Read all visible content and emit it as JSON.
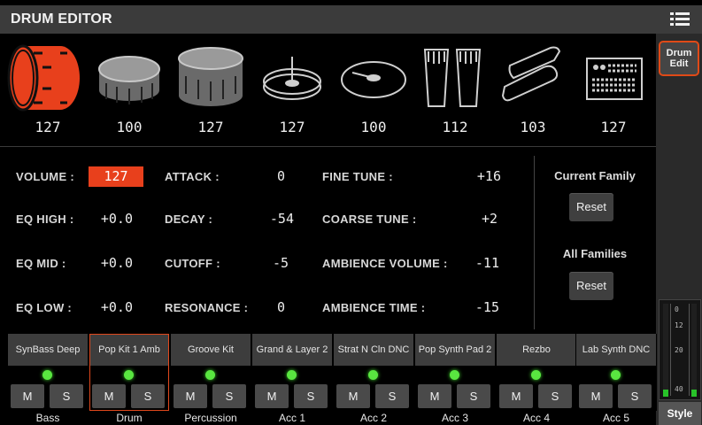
{
  "header": {
    "title": "DRUM EDITOR",
    "menu_icon": "hamburger-menu-icon"
  },
  "sidebar": {
    "drum_edit_label_1": "Drum",
    "drum_edit_label_2": "Edit",
    "style_label": "Style"
  },
  "meter": {
    "ticks": [
      "0",
      "12",
      "20",
      "40"
    ],
    "left_level": 0.08,
    "right_level": 0.08,
    "color": "#28c229"
  },
  "families": [
    {
      "icon": "kick-drum-icon",
      "value": "127",
      "selected": true
    },
    {
      "icon": "snare-drum-icon",
      "value": "100"
    },
    {
      "icon": "tom-drum-icon",
      "value": "127"
    },
    {
      "icon": "hihat-cymbal-icon",
      "value": "127"
    },
    {
      "icon": "ride-cymbal-icon",
      "value": "100"
    },
    {
      "icon": "conga-icon",
      "value": "112"
    },
    {
      "icon": "shaker-icon",
      "value": "103"
    },
    {
      "icon": "drum-machine-icon",
      "value": "127"
    }
  ],
  "params": {
    "volume": {
      "label": "VOLUME :",
      "value": "127"
    },
    "attack": {
      "label": "ATTACK :",
      "value": "0"
    },
    "fine_tune": {
      "label": "FINE TUNE :",
      "value": "+16"
    },
    "eq_high": {
      "label": "EQ HIGH :",
      "value": "+0.0"
    },
    "decay": {
      "label": "DECAY :",
      "value": "-54"
    },
    "coarse_tune": {
      "label": "COARSE TUNE :",
      "value": "+2"
    },
    "eq_mid": {
      "label": "EQ MID :",
      "value": "+0.0"
    },
    "cutoff": {
      "label": "CUTOFF :",
      "value": "-5"
    },
    "ambience_volume": {
      "label": "AMBIENCE VOLUME :",
      "value": "-11"
    },
    "eq_low": {
      "label": "EQ LOW :",
      "value": "+0.0"
    },
    "resonance": {
      "label": "RESONANCE :",
      "value": "0"
    },
    "ambience_time": {
      "label": "AMBIENCE TIME :",
      "value": "-15"
    }
  },
  "reset": {
    "current_family_label": "Current Family",
    "all_families_label": "All Families",
    "reset_label": "Reset"
  },
  "tracks": [
    {
      "name": "SynBass Deep",
      "label": "Bass",
      "m": "M",
      "s": "S"
    },
    {
      "name": "Pop Kit 1 Amb",
      "label": "Drum",
      "m": "M",
      "s": "S",
      "selected": true
    },
    {
      "name": "Groove Kit",
      "label": "Percussion",
      "m": "M",
      "s": "S"
    },
    {
      "name": "Grand & Layer 2",
      "label": "Acc 1",
      "m": "M",
      "s": "S"
    },
    {
      "name": "Strat N Cln DNC",
      "label": "Acc 2",
      "m": "M",
      "s": "S"
    },
    {
      "name": "Pop Synth Pad 2",
      "label": "Acc 3",
      "m": "M",
      "s": "S"
    },
    {
      "name": "Rezbo",
      "label": "Acc 4",
      "m": "M",
      "s": "S"
    },
    {
      "name": "Lab Synth DNC",
      "label": "Acc 5",
      "m": "M",
      "s": "S"
    }
  ],
  "colors": {
    "accent": "#e8401c",
    "led": "#59e640",
    "header_bg": "#3b3b3b"
  }
}
